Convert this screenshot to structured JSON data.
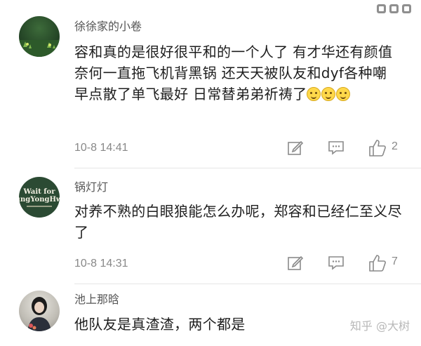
{
  "comments": [
    {
      "nickname": "徐徐家的小卷",
      "text": "容和真的是很好很平和的一个人了 有才华还有颜值 奈何一直拖飞机背黑锅 还天天被队友和dyf各种嘲 早点散了单飞最好 日常替弟弟祈祷了",
      "emoji_count": 3,
      "time": "10-8 14:41",
      "likes": "2"
    },
    {
      "nickname": "锅灯灯",
      "avatar_text_line1": "Wait for",
      "avatar_text_line2": "JungYongHwa",
      "text": "对养不熟的白眼狼能怎么办呢，郑容和已经仁至义尽了",
      "time": "10-8 14:31",
      "likes": "7"
    },
    {
      "nickname": "池上那晗",
      "text": "他队友是真渣渣，两个都是"
    }
  ],
  "watermark": "知乎 @大树",
  "icons": [
    "edit-icon",
    "reply-icon",
    "thumbs-up-icon",
    "smile-emoji-icon"
  ]
}
